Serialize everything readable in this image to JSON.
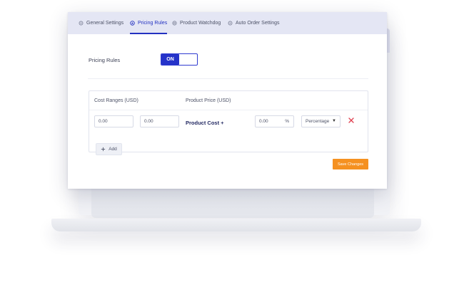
{
  "tabs": [
    {
      "label": "General Settings",
      "icon": "gear-icon",
      "active": false
    },
    {
      "label": "Pricing Rules",
      "icon": "pricing-icon",
      "active": true
    },
    {
      "label": "Product Watchdog",
      "icon": "watchdog-icon",
      "active": false
    },
    {
      "label": "Auto Order Settings",
      "icon": "gear-icon",
      "active": false
    }
  ],
  "pricing_rules": {
    "label": "Pricing Rules",
    "toggle_state": "ON"
  },
  "table": {
    "cost_ranges_header": "Cost Ranges (USD)",
    "product_price_header": "Product Price (USD)",
    "rows": [
      {
        "cost_min": "0.00",
        "cost_max": "0.00",
        "formula_label": "Product Cost +",
        "markup_value": "0.00",
        "markup_unit": "%",
        "markup_type": "Percentage"
      }
    ],
    "add_label": "Add"
  },
  "save_label": "Save Changes",
  "colors": {
    "accent": "#2331c1",
    "save_button": "#f59121",
    "delete_icon": "#e0404f"
  }
}
